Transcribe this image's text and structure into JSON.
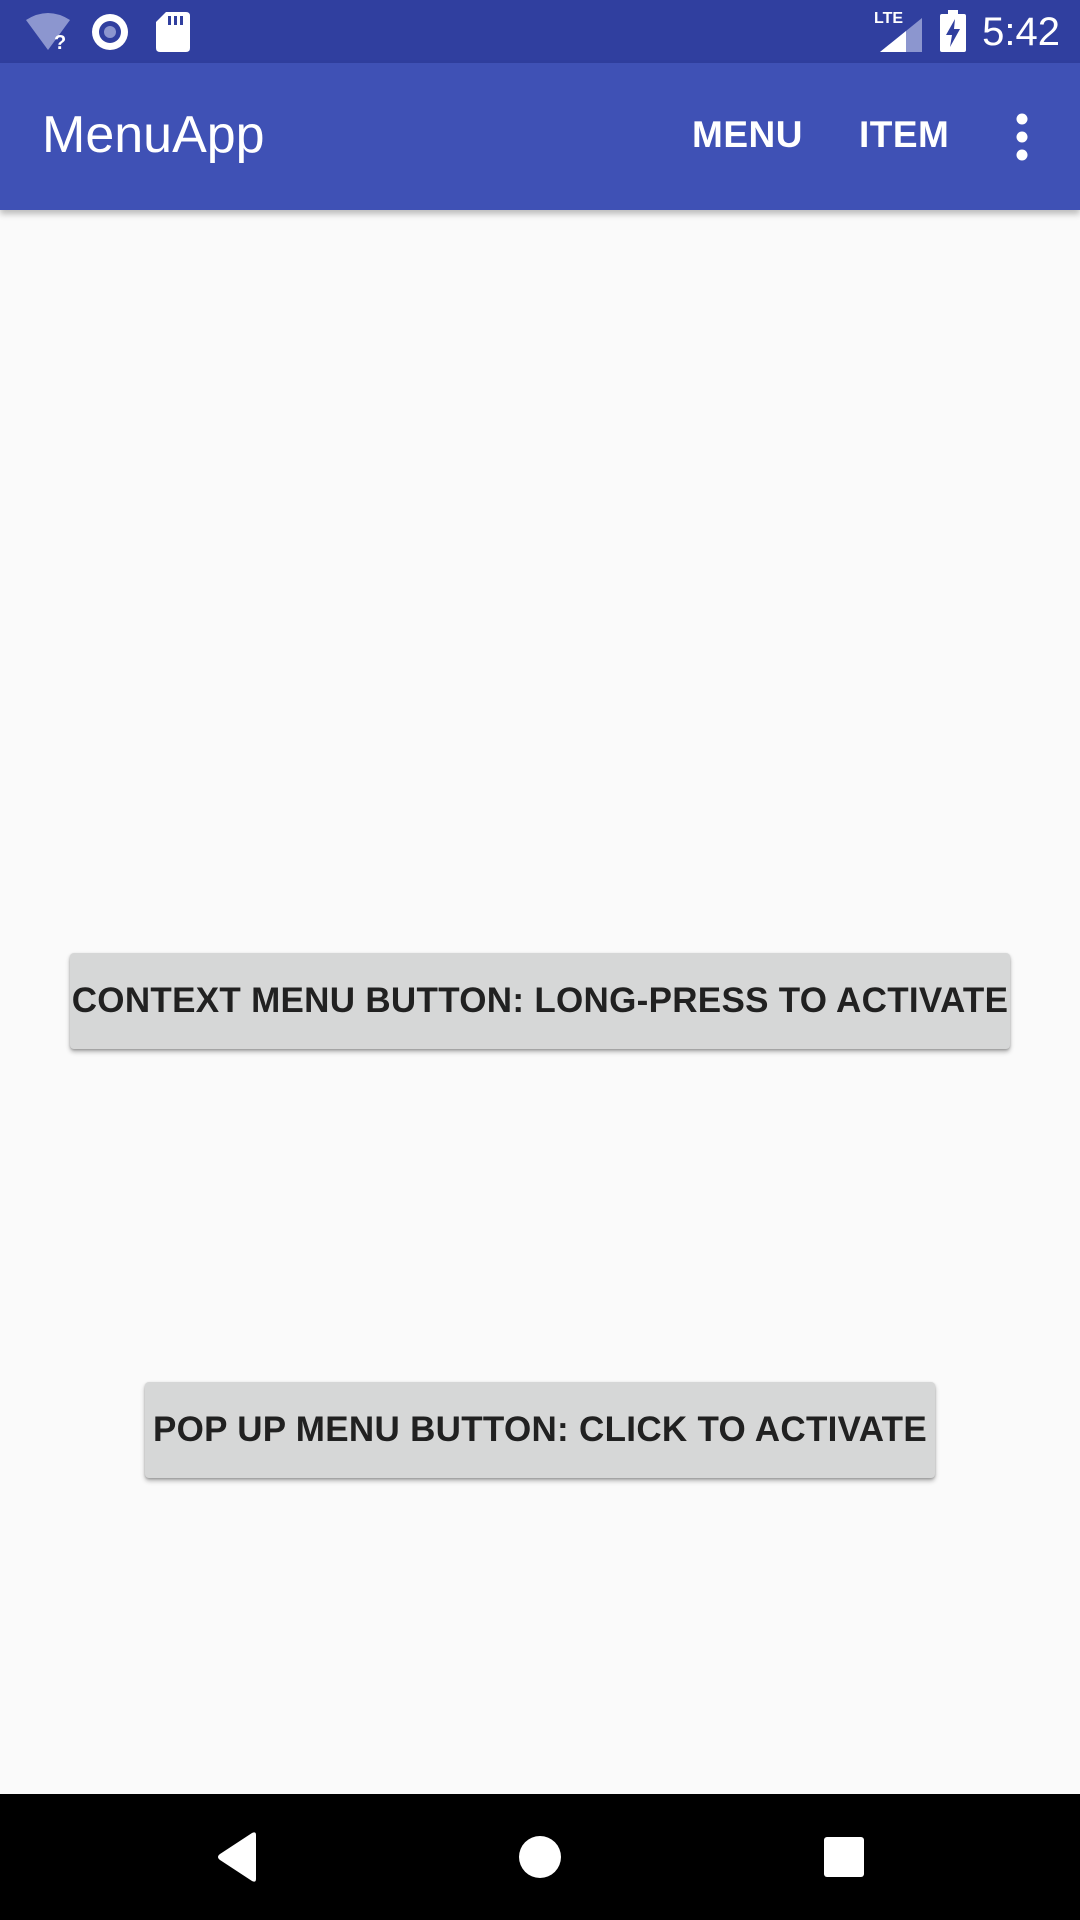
{
  "status_bar": {
    "time": "5:42",
    "network_label": "LTE",
    "icons": [
      "wifi-unknown-icon",
      "sync-icon",
      "sd-card-icon",
      "lte-signal-icon",
      "battery-charging-icon"
    ]
  },
  "app_bar": {
    "title": "MenuApp",
    "actions": {
      "menu_label": "MENU",
      "item_label": "ITEM"
    },
    "overflow_icon": "more-vert-icon"
  },
  "main": {
    "context_button_label": "CONTEXT MENU BUTTON: LONG-PRESS TO ACTIVATE",
    "popup_button_label": "POP UP MENU BUTTON: CLICK TO ACTIVATE"
  },
  "nav_bar": {
    "icons": [
      "back-icon",
      "home-icon",
      "recents-icon"
    ]
  },
  "colors": {
    "status_bar": "#303f9f",
    "app_bar": "#3f51b5",
    "background": "#fafafa",
    "button": "#d6d7d7",
    "button_text": "#212121",
    "nav_bar": "#000000"
  }
}
